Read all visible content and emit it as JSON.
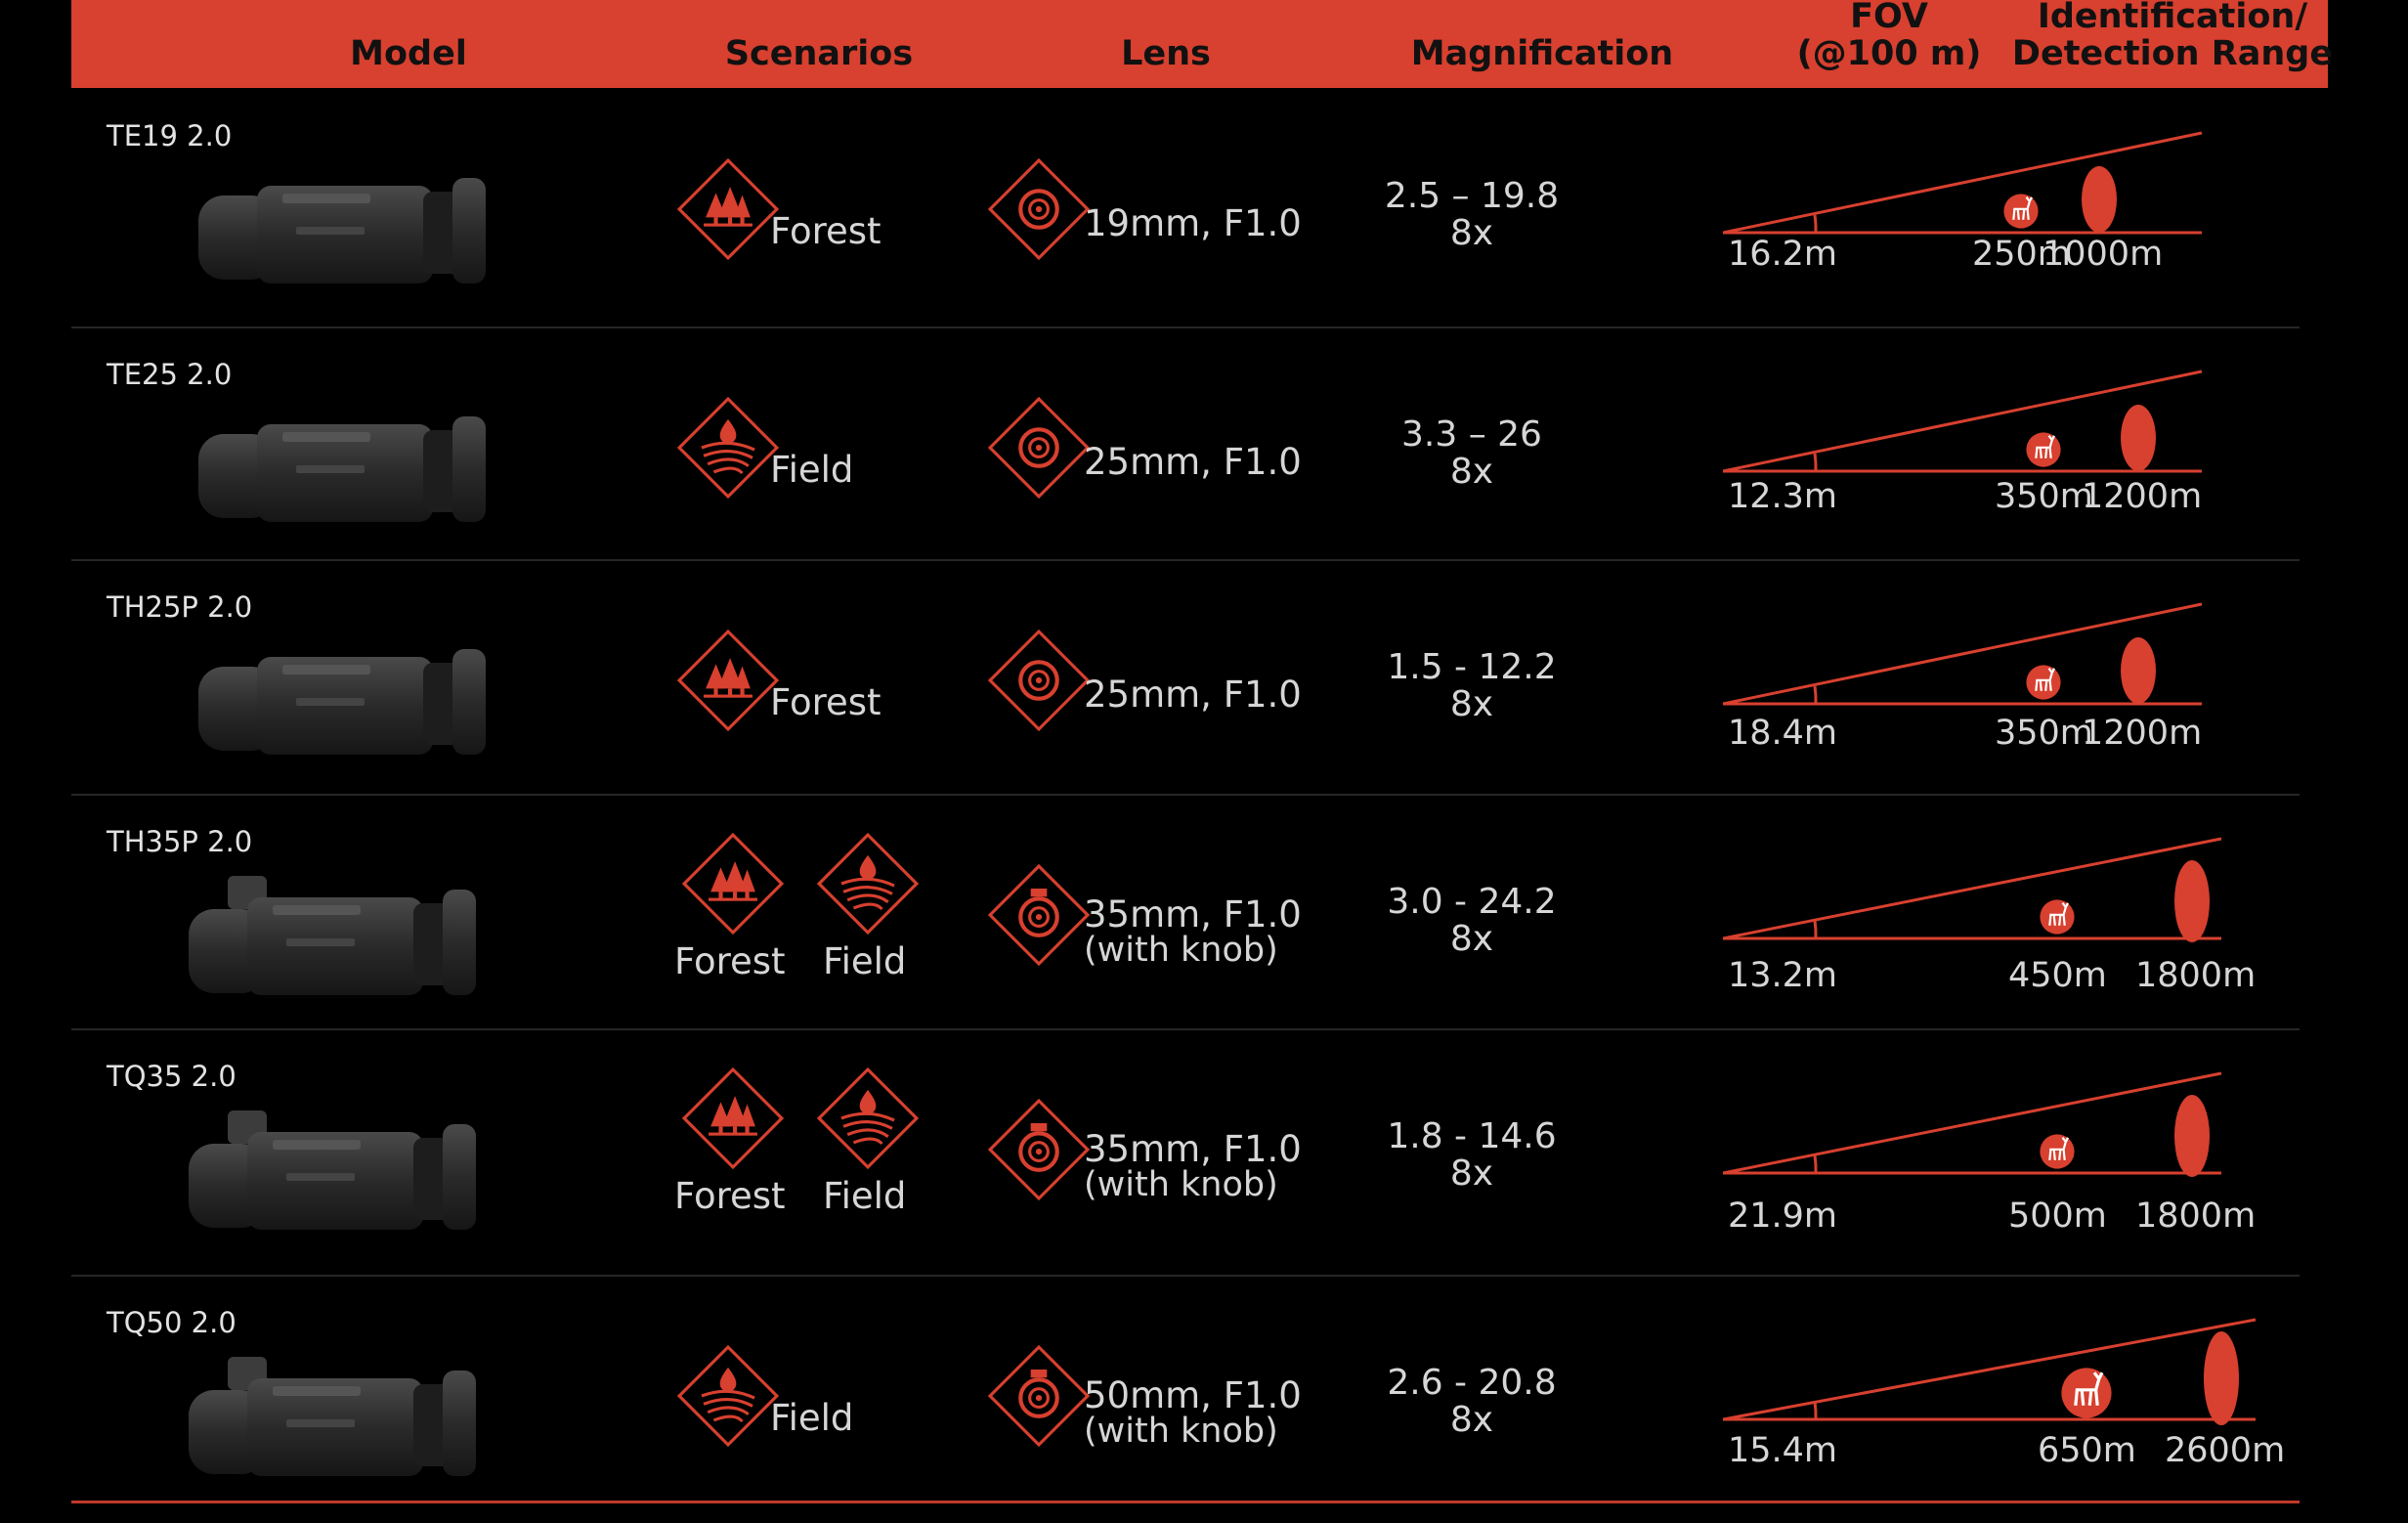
{
  "colors": {
    "accent": "#d8402f",
    "background": "#000000",
    "text": "#d6d6d6"
  },
  "header": {
    "model": "Model",
    "scenarios": "Scenarios",
    "lens": "Lens",
    "magnification": "Magnification",
    "fov_line1": "FOV",
    "fov_line2": "(@100 m)",
    "range_line1": "Identification/",
    "range_line2": "Detection Range"
  },
  "rows": [
    {
      "model": "TE19 2.0",
      "scenarios": [
        "Forest"
      ],
      "scenario_icons": [
        "forest-icon"
      ],
      "lens_icon": "lens-icon",
      "lens": "19mm, F1.0",
      "lens_note": "",
      "mag_range": "2.5 – 19.8",
      "mag_zoom": "8x",
      "fov": "16.2m",
      "identification": "250m",
      "detection": "1000m"
    },
    {
      "model": "TE25 2.0",
      "scenarios": [
        "Field"
      ],
      "scenario_icons": [
        "field-icon"
      ],
      "lens_icon": "lens-icon",
      "lens": "25mm, F1.0",
      "lens_note": "",
      "mag_range": "3.3 – 26",
      "mag_zoom": "8x",
      "fov": "12.3m",
      "identification": "350m",
      "detection": "1200m"
    },
    {
      "model": "TH25P 2.0",
      "scenarios": [
        "Forest"
      ],
      "scenario_icons": [
        "forest-icon"
      ],
      "lens_icon": "lens-icon",
      "lens": "25mm, F1.0",
      "lens_note": "",
      "mag_range": "1.5 - 12.2",
      "mag_zoom": "8x",
      "fov": "18.4m",
      "identification": "350m",
      "detection": "1200m"
    },
    {
      "model": "TH35P 2.0",
      "scenarios": [
        "Forest",
        "Field"
      ],
      "scenario_icons": [
        "forest-icon",
        "field-icon"
      ],
      "lens_icon": "lens-knob-icon",
      "lens": "35mm, F1.0",
      "lens_note": "(with knob)",
      "mag_range": "3.0 - 24.2",
      "mag_zoom": "8x",
      "fov": "13.2m",
      "identification": "450m",
      "detection": "1800m"
    },
    {
      "model": "TQ35 2.0",
      "scenarios": [
        "Forest",
        "Field"
      ],
      "scenario_icons": [
        "forest-icon",
        "field-icon"
      ],
      "lens_icon": "lens-knob-icon",
      "lens": "35mm, F1.0",
      "lens_note": "(with knob)",
      "mag_range": "1.8 - 14.6",
      "mag_zoom": "8x",
      "fov": "21.9m",
      "identification": "500m",
      "detection": "1800m"
    },
    {
      "model": "TQ50 2.0",
      "scenarios": [
        "Field"
      ],
      "scenario_icons": [
        "field-icon"
      ],
      "lens_icon": "lens-knob-icon",
      "lens": "50mm, F1.0",
      "lens_note": "(with knob)",
      "mag_range": "2.6 - 20.8",
      "mag_zoom": "8x",
      "fov": "15.4m",
      "identification": "650m",
      "detection": "2600m"
    }
  ]
}
